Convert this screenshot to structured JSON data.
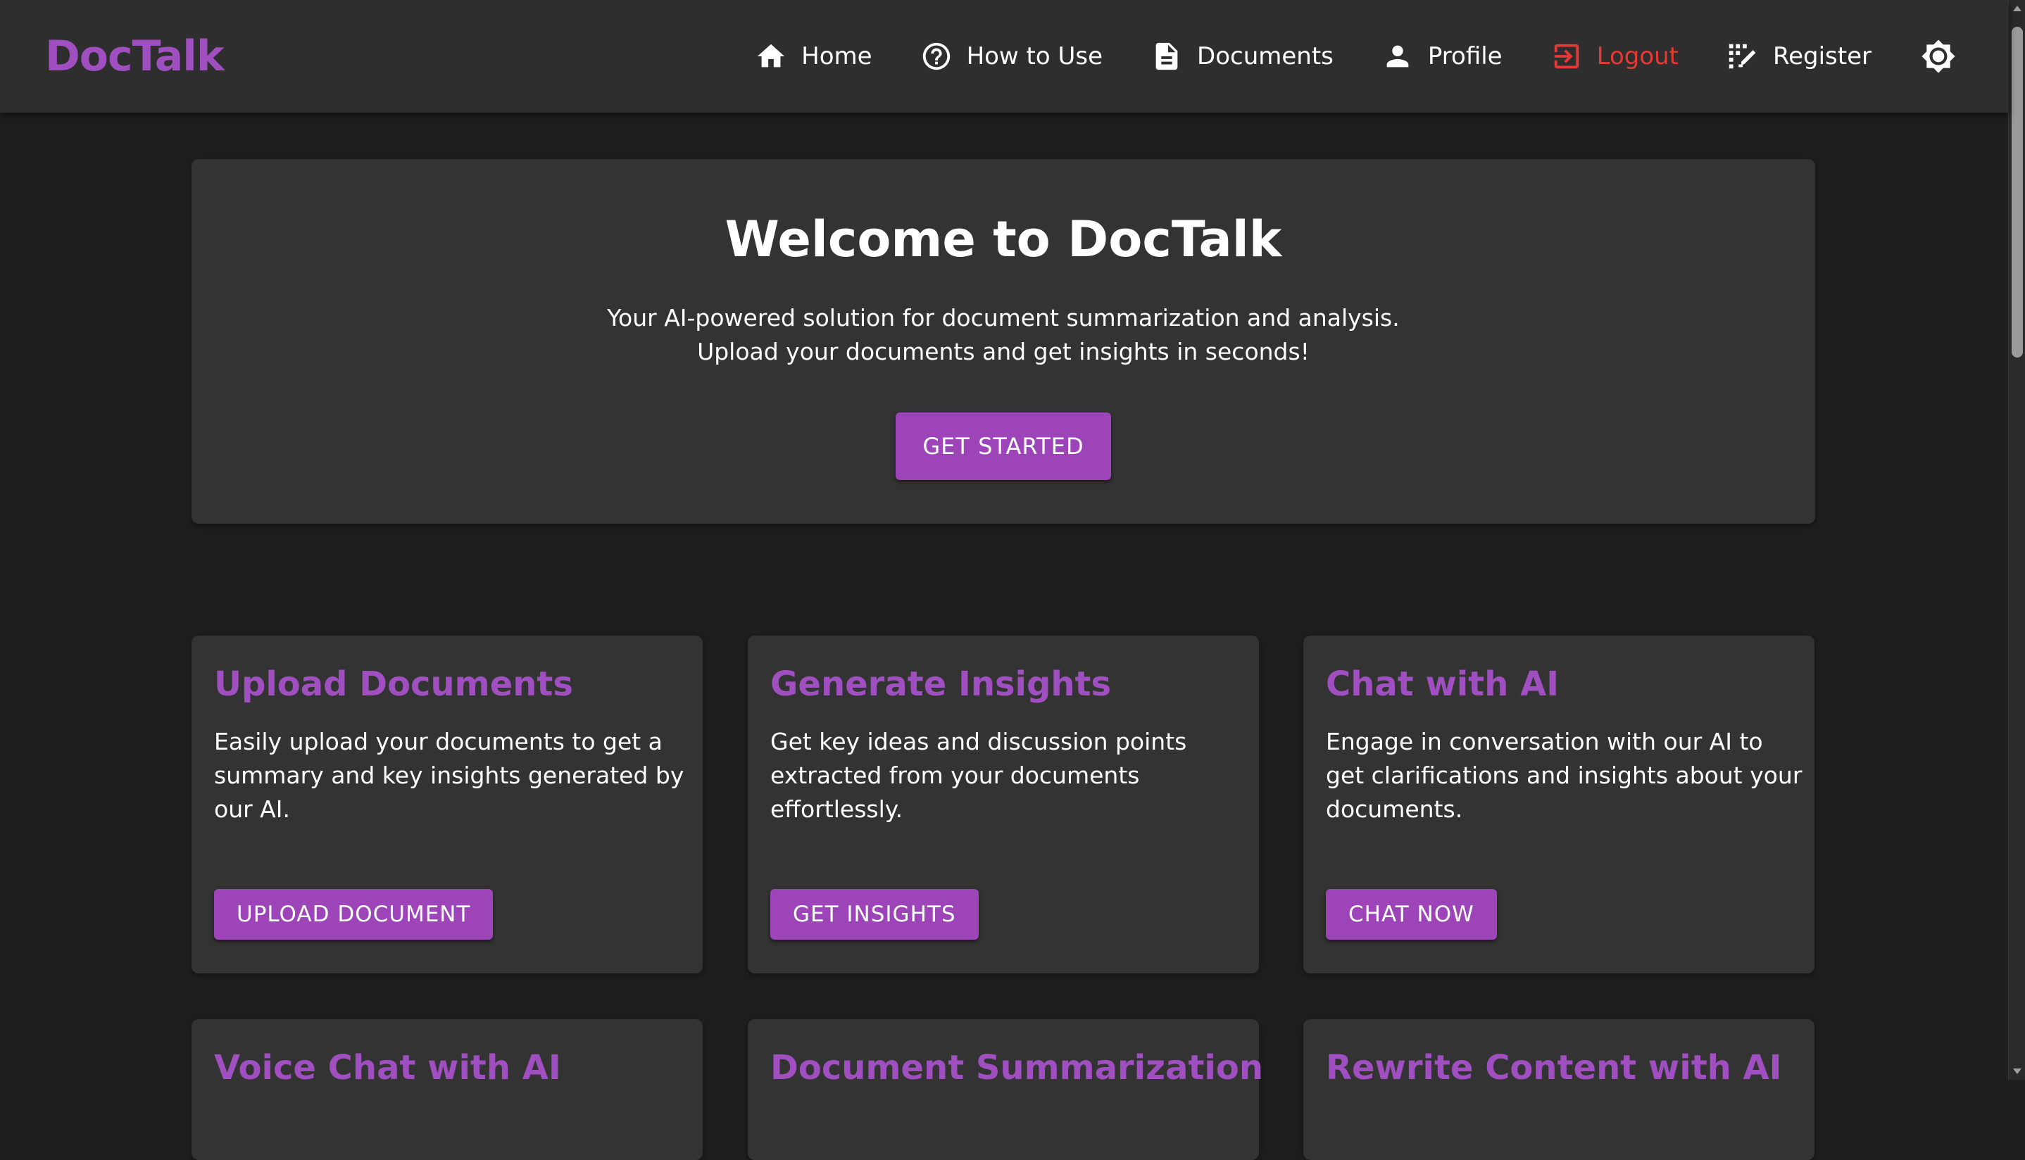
{
  "app": {
    "brand": "DocTalk",
    "accent_color": "#a04fc0",
    "background_color": "#1e1e1e"
  },
  "nav": {
    "items": [
      {
        "label": "Home",
        "icon": "home-icon"
      },
      {
        "label": "How to Use",
        "icon": "help-circle-icon"
      },
      {
        "label": "Documents",
        "icon": "document-icon"
      },
      {
        "label": "Profile",
        "icon": "person-icon"
      },
      {
        "label": "Logout",
        "icon": "logout-icon",
        "color": "#e53935"
      },
      {
        "label": "Register",
        "icon": "register-icon"
      }
    ],
    "theme_toggle_icon": "brightness-icon"
  },
  "hero": {
    "title": "Welcome to DocTalk",
    "subtitle_line1": "Your AI-powered solution for document summarization and analysis.",
    "subtitle_line2": "Upload your documents and get insights in seconds!",
    "cta_label": "GET STARTED"
  },
  "features": [
    {
      "title": "Upload Documents",
      "description": "Easily upload your documents to get a summary and key insights generated by our AI.",
      "button_label": "UPLOAD DOCUMENT"
    },
    {
      "title": "Generate Insights",
      "description": "Get key ideas and discussion points extracted from your documents effortlessly.",
      "button_label": "GET INSIGHTS"
    },
    {
      "title": "Chat with AI",
      "description": "Engage in conversation with our AI to get clarifications and insights about your documents.",
      "button_label": "CHAT NOW"
    },
    {
      "title": "Voice Chat with AI"
    },
    {
      "title": "Document Summarization"
    },
    {
      "title": "Rewrite Content with AI"
    }
  ]
}
